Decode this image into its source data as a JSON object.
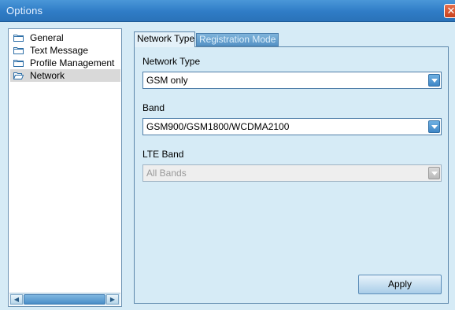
{
  "window": {
    "title": "Options",
    "close_symbol": "✕"
  },
  "tree": {
    "items": [
      {
        "label": "General",
        "icon": "folder-icon",
        "selected": false
      },
      {
        "label": "Text Message",
        "icon": "folder-icon",
        "selected": false
      },
      {
        "label": "Profile Management",
        "icon": "folder-icon",
        "selected": false
      },
      {
        "label": "Network",
        "icon": "folder-open-icon",
        "selected": true
      }
    ],
    "scroll_left": "◀",
    "scroll_right": "▶"
  },
  "tabs": [
    {
      "label": "Network Type",
      "active": true
    },
    {
      "label": "Registration Mode",
      "active": false
    }
  ],
  "form": {
    "network_type": {
      "label": "Network Type",
      "value": "GSM only"
    },
    "band": {
      "label": "Band",
      "value": "GSM900/GSM1800/WCDMA2100"
    },
    "lte_band": {
      "label": "LTE Band",
      "value": "All Bands",
      "disabled": true
    }
  },
  "buttons": {
    "apply": "Apply"
  },
  "colors": {
    "titlebar": "#2f7cc6",
    "background": "#d6ebf6",
    "accent": "#3f86c6"
  }
}
